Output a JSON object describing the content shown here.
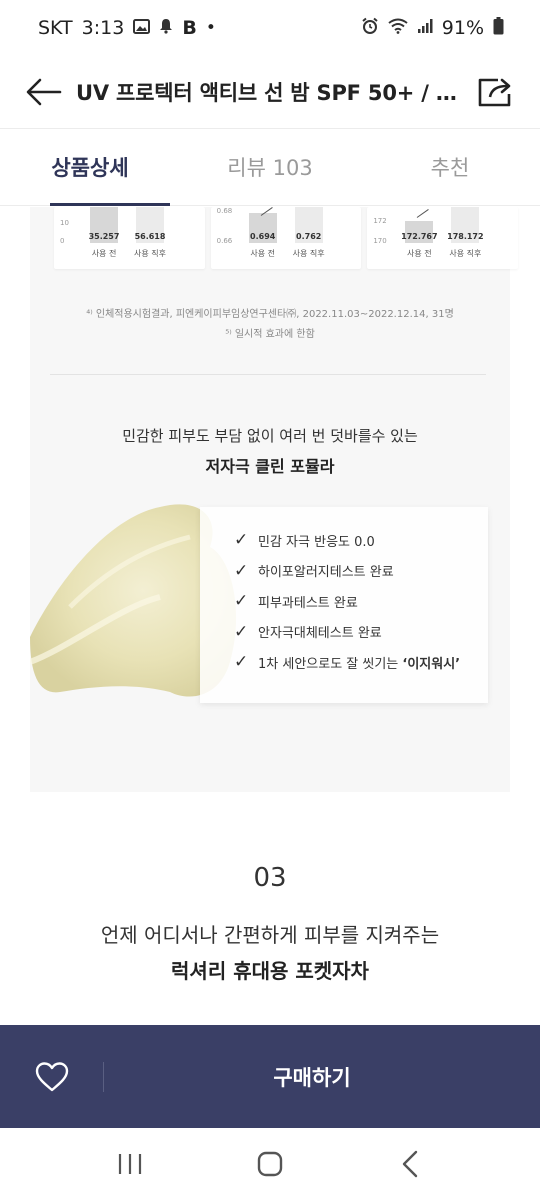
{
  "status": {
    "carrier": "SKT",
    "time": "3:13",
    "battery": "91%",
    "icons_left": [
      "image-icon",
      "bell-icon",
      "b-app-icon",
      "dot-icon"
    ],
    "icons_right": [
      "alarm-icon",
      "wifi-icon",
      "signal-icon",
      "battery-icon"
    ]
  },
  "appbar": {
    "title": "UV 프로텍터 액티브 선 밤 SPF 50+ / …"
  },
  "tabs": [
    {
      "label": "상품상세",
      "active": true
    },
    {
      "label": "리뷰 103",
      "active": false
    },
    {
      "label": "추천",
      "active": false
    }
  ],
  "charts": [
    {
      "ticks": [
        "10",
        "0"
      ],
      "before": "35.257",
      "after": "56.618",
      "label_before": "사용 전",
      "label_after": "사용 직후"
    },
    {
      "ticks": [
        "0.68",
        "0.66"
      ],
      "before": "0.694",
      "after": "0.762",
      "label_before": "사용 전",
      "label_after": "사용 직후"
    },
    {
      "ticks": [
        "172",
        "170"
      ],
      "before": "172.767",
      "after": "178.172",
      "label_before": "사용 전",
      "label_after": "사용 직후"
    }
  ],
  "footnotes": {
    "note1": "⁴⁾ 인체적용시험결과, 피엔케이피부임상연구센타㈜, 2022.11.03~2022.12.14, 31명",
    "note2": "⁵⁾ 일시적 효과에 한함"
  },
  "section2": {
    "heading1": "민감한 피부도 부담 없이 여러 번 덧바를수 있는",
    "heading2": "저자극 클린 포뮬라",
    "checks": [
      {
        "bold": "민감 자극 반응도 0.0",
        "rest": ""
      },
      {
        "bold": "하이포알러지테스트",
        "rest": " 완료"
      },
      {
        "bold": "피부과테스트",
        "rest": " 완료"
      },
      {
        "bold": "안자극대체테스트",
        "rest": " 완료"
      },
      {
        "bold": "",
        "rest": "1차 세안으로도 잘 씻기는 ",
        "quote": "‘이지워시’"
      }
    ]
  },
  "section3": {
    "number": "03",
    "line1": "언제 어디서나 간편하게 피부를 지켜주는",
    "line2": "럭셔리 휴대용 포켓자차"
  },
  "buybar": {
    "buy_label": "구매하기"
  },
  "colors": {
    "accent": "#2f3558",
    "buybar": "#3a3f66"
  }
}
